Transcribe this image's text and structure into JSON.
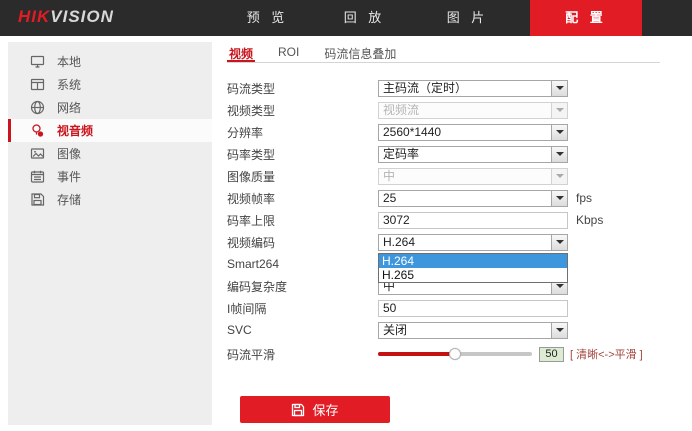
{
  "topbar": {
    "logo_hik": "HIK",
    "logo_vision": "VISION",
    "nav": [
      {
        "label": "预 览",
        "active": false
      },
      {
        "label": "回 放",
        "active": false
      },
      {
        "label": "图 片",
        "active": false
      },
      {
        "label": "配 置",
        "active": true
      }
    ]
  },
  "sidebar": {
    "items": [
      {
        "label": "本地",
        "icon": "monitor-icon",
        "selected": false
      },
      {
        "label": "系统",
        "icon": "system-icon",
        "selected": false
      },
      {
        "label": "网络",
        "icon": "network-icon",
        "selected": false
      },
      {
        "label": "视音频",
        "icon": "audio-video-icon",
        "selected": true
      },
      {
        "label": "图像",
        "icon": "image-icon",
        "selected": false
      },
      {
        "label": "事件",
        "icon": "event-icon",
        "selected": false
      },
      {
        "label": "存储",
        "icon": "storage-icon",
        "selected": false
      }
    ]
  },
  "tabs": [
    {
      "label": "视频",
      "active": true
    },
    {
      "label": "ROI",
      "active": false
    },
    {
      "label": "码流信息叠加",
      "active": false
    }
  ],
  "form": {
    "rows": [
      {
        "label": "码流类型",
        "type": "select",
        "value": "主码流（定时）",
        "disabled": false
      },
      {
        "label": "视频类型",
        "type": "select",
        "value": "视频流",
        "disabled": true
      },
      {
        "label": "分辨率",
        "type": "select",
        "value": "2560*1440",
        "disabled": false
      },
      {
        "label": "码率类型",
        "type": "select",
        "value": "定码率",
        "disabled": false
      },
      {
        "label": "图像质量",
        "type": "select",
        "value": "中",
        "disabled": true
      },
      {
        "label": "视频帧率",
        "type": "select",
        "value": "25",
        "disabled": false,
        "suffix": "fps"
      },
      {
        "label": "码率上限",
        "type": "text",
        "value": "3072",
        "suffix": "Kbps"
      },
      {
        "label": "视频编码",
        "type": "select-open",
        "value": "H.264",
        "options": [
          "H.264",
          "H.265"
        ],
        "selected_option": "H.264"
      },
      {
        "label": "Smart264",
        "type": "covered"
      },
      {
        "label": "编码复杂度",
        "type": "select",
        "value": "中",
        "disabled": false
      },
      {
        "label": "I帧间隔",
        "type": "text",
        "value": "50"
      },
      {
        "label": "SVC",
        "type": "select",
        "value": "关闭",
        "disabled": false
      },
      {
        "label": "码流平滑",
        "type": "slider",
        "value": 50,
        "min": 0,
        "max": 100,
        "hint": "[ 清晰<->平滑 ]"
      }
    ]
  },
  "save_button": {
    "label": "保存"
  },
  "colors": {
    "brand_red": "#e21c25",
    "sidebar_red": "#c9161e",
    "topbar_bg": "#2b2b2b",
    "dropdown_highlight_blue": "#3e96dc",
    "slider_fill_red": "#c41111",
    "slider_value_green_bg": "#dcebd1",
    "hint_text": "#a1443c"
  }
}
